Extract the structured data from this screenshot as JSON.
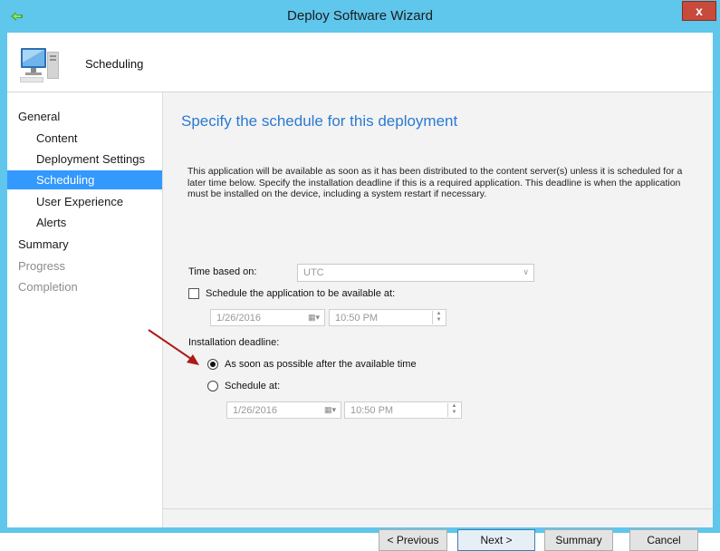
{
  "window": {
    "title": "Deploy Software Wizard",
    "close_label": "x"
  },
  "header": {
    "title": "Scheduling"
  },
  "nav": {
    "items": [
      {
        "label": "General"
      },
      {
        "label": "Content"
      },
      {
        "label": "Deployment Settings"
      },
      {
        "label": "Scheduling"
      },
      {
        "label": "User Experience"
      },
      {
        "label": "Alerts"
      },
      {
        "label": "Summary"
      },
      {
        "label": "Progress"
      },
      {
        "label": "Completion"
      }
    ],
    "selected": "Scheduling"
  },
  "main": {
    "title": "Specify the schedule for this deployment",
    "description": "This application will be available as soon as it has been distributed to the content server(s) unless it is scheduled for a later time below. Specify the installation deadline if this is a required application. This deadline is when the application must be installed on the device, including a system restart if necessary.",
    "time_based_on": {
      "label": "Time based on:",
      "value": "UTC"
    },
    "schedule_available": {
      "label": "Schedule the application to be available at:",
      "checked": false,
      "date": "1/26/2016",
      "time": "10:50 PM"
    },
    "installation_deadline": {
      "label": "Installation deadline:",
      "asap_label": "As soon as possible after the available time",
      "schedule_label": "Schedule at:",
      "selected": "asap",
      "date": "1/26/2016",
      "time": "10:50 PM"
    }
  },
  "buttons": {
    "previous": "< Previous",
    "next": "Next >",
    "summary": "Summary",
    "cancel": "Cancel"
  },
  "colors": {
    "titlebar": "#5fc6ec",
    "accent_title": "#2a7ad0",
    "nav_selected": "#3399ff",
    "close": "#c74a3a",
    "annotation_arrow": "#b01818"
  }
}
